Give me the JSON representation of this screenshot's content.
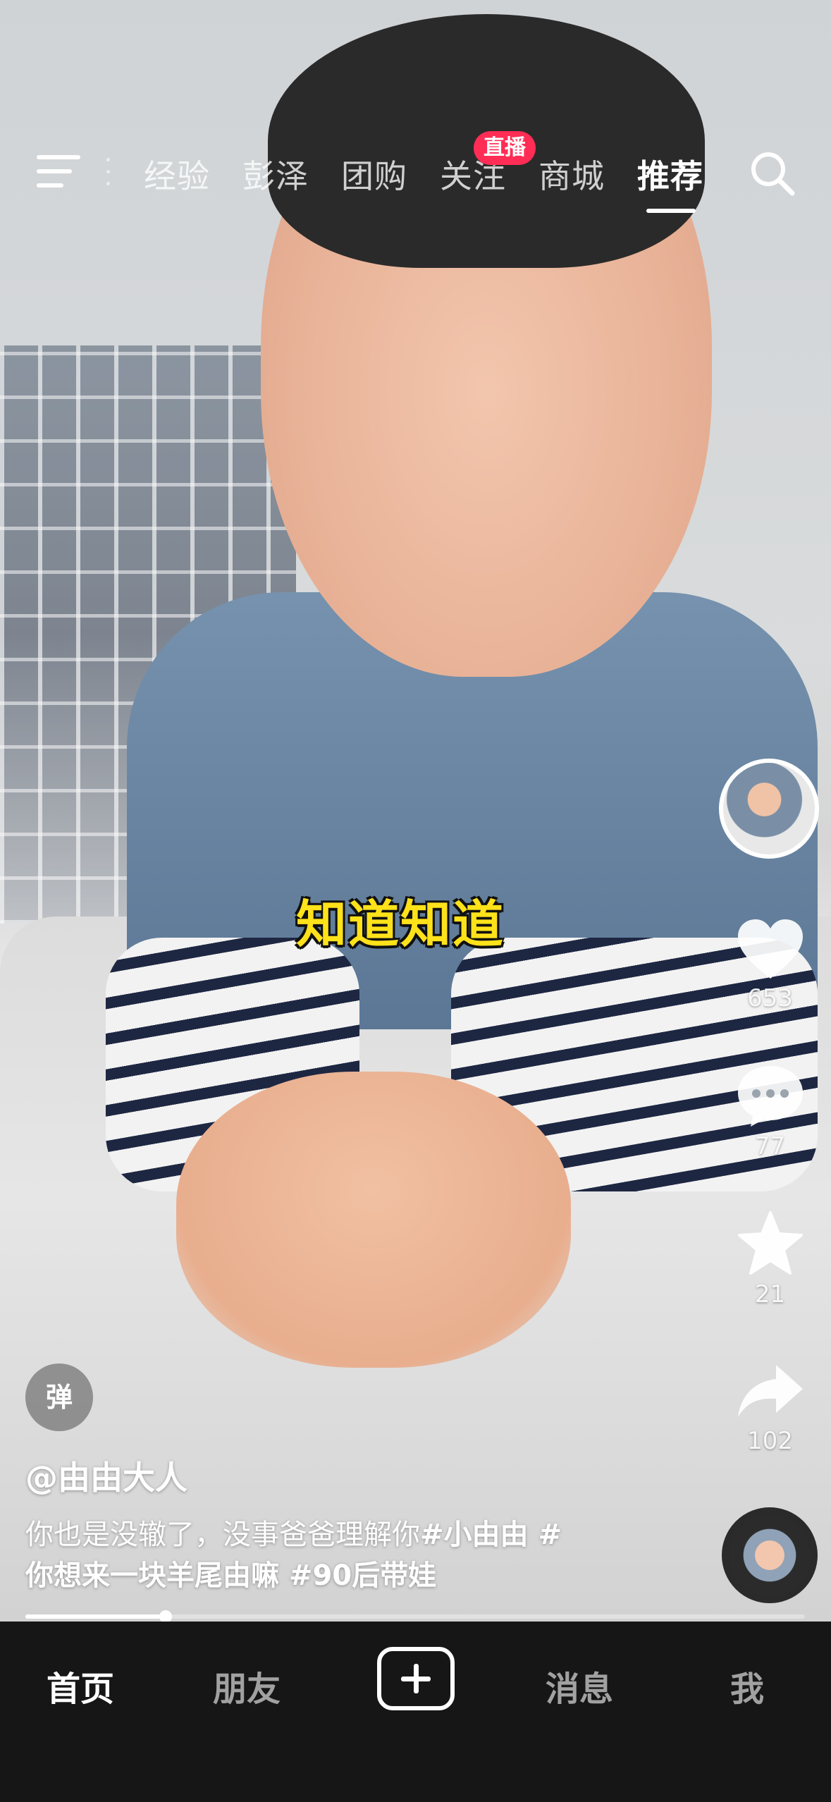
{
  "top_nav": {
    "tabs": [
      "经验",
      "彭泽",
      "团购",
      "关注",
      "商城",
      "推荐"
    ],
    "active_tab": "推荐",
    "live_badge": "直播"
  },
  "video": {
    "caption": "知道知道"
  },
  "actions": {
    "likes": "653",
    "comments": "77",
    "favorites": "21",
    "shares": "102"
  },
  "danmaku_label": "弹",
  "post": {
    "author": "@由由大人",
    "description_line1": "你也是没辙了，没事爸爸理解你",
    "hashtag1": "#小由由",
    "hashtag2_prefix": " #",
    "description_line2": "你想来一块羊尾由嘛",
    "hashtag3": " #90后带娃"
  },
  "playback": {
    "progress_fraction": 0.18
  },
  "bottom_nav": {
    "home": "首页",
    "friends": "朋友",
    "messages": "消息",
    "me": "我"
  }
}
